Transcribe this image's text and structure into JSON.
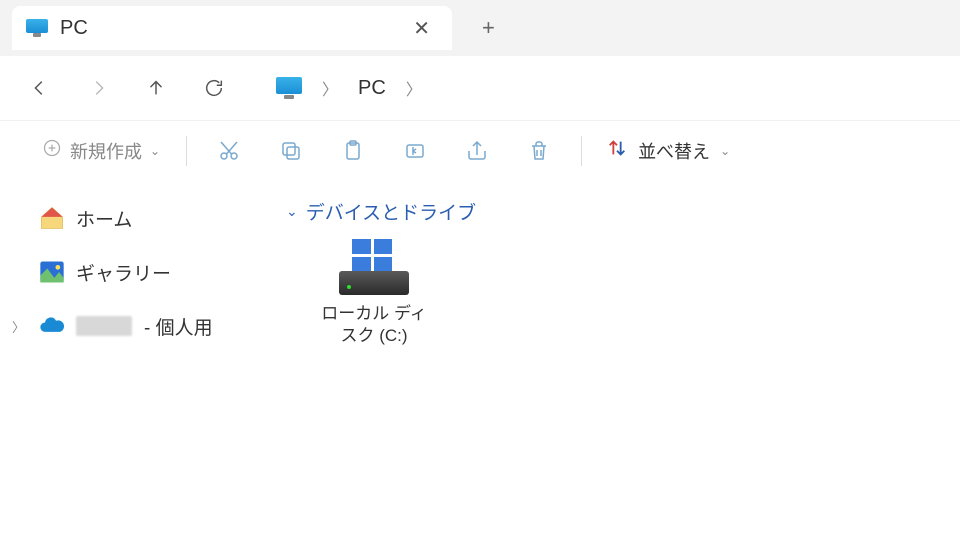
{
  "tab": {
    "title": "PC"
  },
  "breadcrumb": {
    "location": "PC"
  },
  "toolbar": {
    "new_label": "新規作成",
    "sort_label": "並べ替え"
  },
  "sidebar": {
    "items": [
      {
        "label": "ホーム"
      },
      {
        "label": "ギャラリー"
      },
      {
        "label_suffix": "- 個人用"
      }
    ]
  },
  "main": {
    "section_title": "デバイスとドライブ",
    "drives": [
      {
        "name": "ローカル ディスク (C:)"
      }
    ]
  }
}
